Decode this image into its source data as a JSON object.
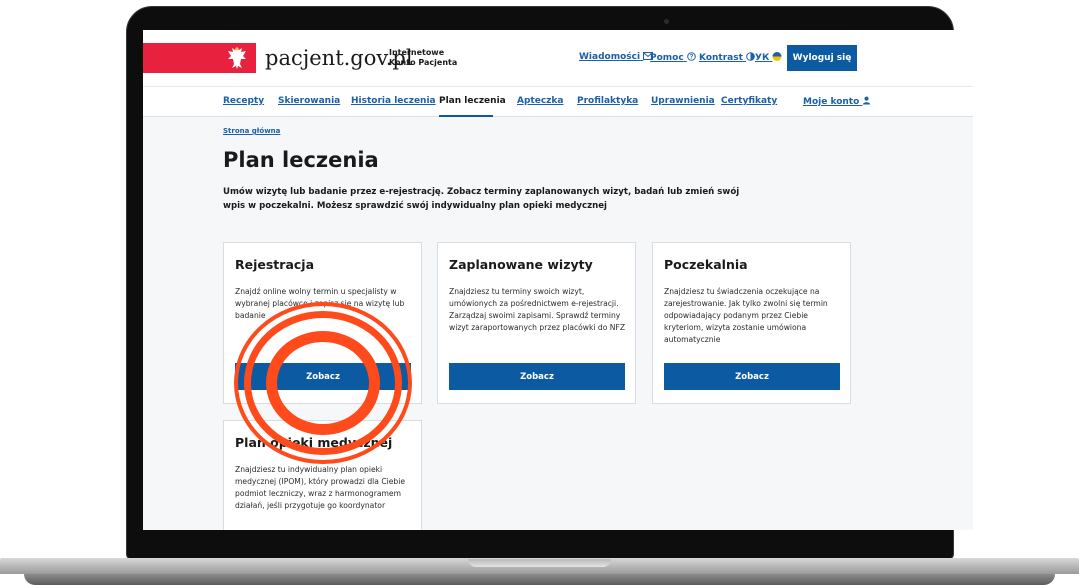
{
  "header": {
    "brand": "pacjent.gov.pl",
    "brand_sub_line1": "Internetowe",
    "brand_sub_line2": "Konto Pacjenta",
    "links": {
      "news": "Wiadomości",
      "help": "Pomoc",
      "contrast": "Kontrast",
      "lang": "УК"
    },
    "logout_label": "Wyloguj się"
  },
  "nav": {
    "items": [
      "Recepty",
      "Skierowania",
      "Historia leczenia",
      "Plan leczenia",
      "Apteczka",
      "Profilaktyka",
      "Uprawnienia",
      "Certyfikaty"
    ],
    "account": "Moje konto"
  },
  "breadcrumb": "Strona główna",
  "page": {
    "title": "Plan leczenia",
    "intro": "Umów wizytę lub badanie przez e-rejestrację. Zobacz terminy zaplanowanych wizyt, badań lub zmień swój wpis w poczekalni. Możesz sprawdzić swój indywidualny plan opieki medycznej"
  },
  "cards": [
    {
      "title": "Rejestracja",
      "text": "Znajdź online wolny termin u specjalisty w wybranej placówce i zapisz się na wizytę lub badanie",
      "button": "Zobacz"
    },
    {
      "title": "Zaplanowane wizyty",
      "text": "Znajdziesz tu terminy swoich wizyt, umówionych za pośrednictwem e-rejestracji. Zarządzaj swoimi zapisami. Sprawdź terminy wizyt zaraportowanych przez placówki do NFZ",
      "button": "Zobacz"
    },
    {
      "title": "Poczekalnia",
      "text": "Znajdziesz tu świadczenia oczekujące na zarejestrowanie. Jak tylko zwolni się termin odpowiadający podanym przez Ciebie kryteriom, wizyta zostanie umówiona automatycznie",
      "button": "Zobacz"
    },
    {
      "title": "Plan opieki medycznej",
      "text": "Znajdziesz tu indywidualny plan opieki medycznej (IPOM), który prowadzi dla Ciebie podmiot leczniczy, wraz z harmonogramem działań, jeśli przygotuje go koordynator",
      "button": ""
    }
  ],
  "colors": {
    "accent": "#0b5aa2",
    "link": "#1b5fa8",
    "flag_red": "#e8213f",
    "highlight": "#ff4a1c"
  }
}
